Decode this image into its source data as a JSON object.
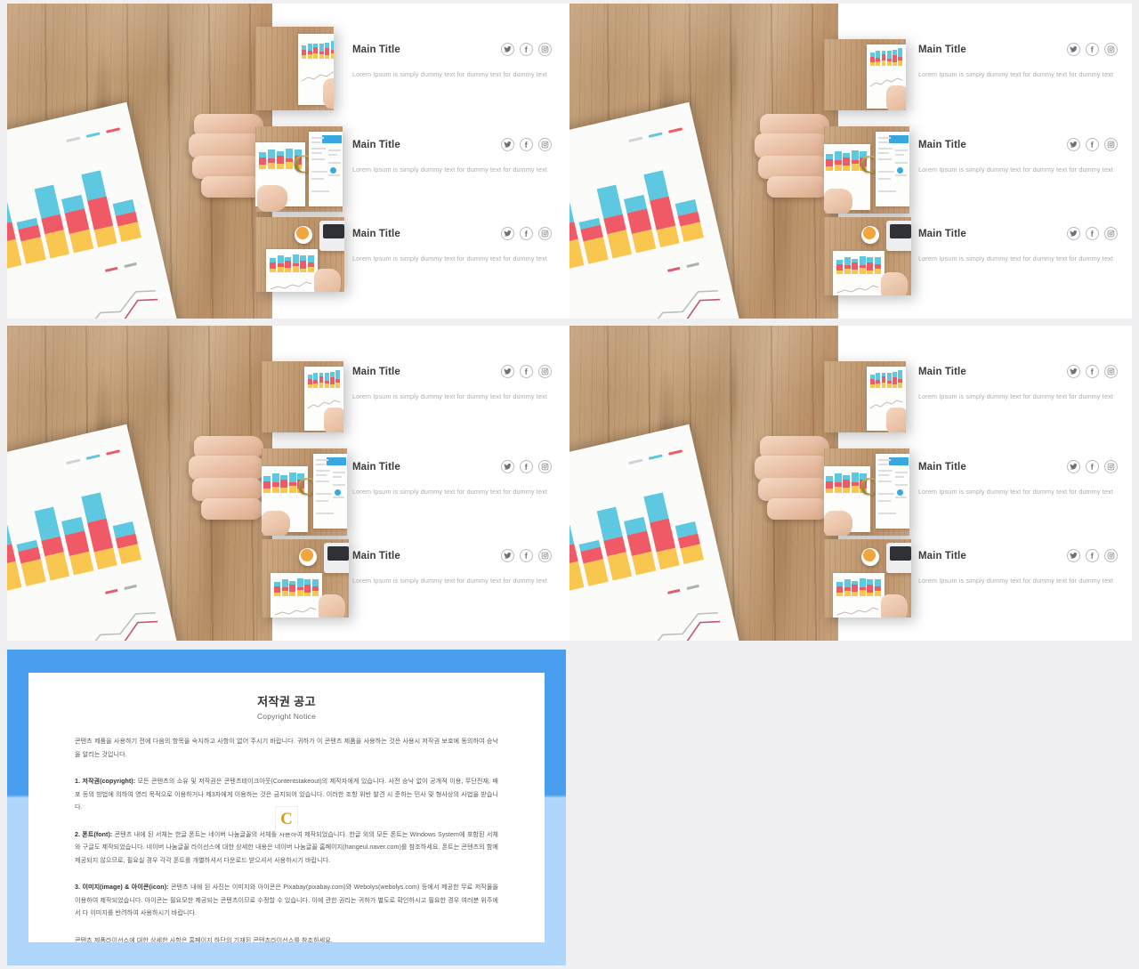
{
  "slides": [
    {
      "id": "slide-1",
      "entries": [
        {
          "title": "Main Title",
          "desc": "Lorem Ipsum is simply dummy text for dummy text for dummy text"
        },
        {
          "title": "Main Title",
          "desc": "Lorem Ipsum is simply dummy text for dummy text for dummy text"
        },
        {
          "title": "Main Title",
          "desc": "Lorem Ipsum is simply dummy text for dummy text for dummy text"
        }
      ]
    },
    {
      "id": "slide-2",
      "entries": [
        {
          "title": "Main Title",
          "desc": "Lorem Ipsum is simply dummy text for dummy text for dummy text"
        },
        {
          "title": "Main Title",
          "desc": "Lorem Ipsum is simply dummy text for dummy text for dummy text"
        },
        {
          "title": "Main Title",
          "desc": "Lorem Ipsum is simply dummy text for dummy text for dummy text"
        }
      ]
    },
    {
      "id": "slide-3",
      "entries": [
        {
          "title": "Main Title",
          "desc": "Lorem Ipsum is simply dummy text for dummy text for dummy text"
        },
        {
          "title": "Main Title",
          "desc": "Lorem Ipsum is simply dummy text for dummy text for dummy text"
        },
        {
          "title": "Main Title",
          "desc": "Lorem Ipsum is simply dummy text for dummy text for dummy text"
        }
      ]
    },
    {
      "id": "slide-4",
      "entries": [
        {
          "title": "Main Title",
          "desc": "Lorem Ipsum is simply dummy text for dummy text for dummy text"
        },
        {
          "title": "Main Title",
          "desc": "Lorem Ipsum is simply dummy text for dummy text for dummy text"
        },
        {
          "title": "Main Title",
          "desc": "Lorem Ipsum is simply dummy text for dummy text for dummy text"
        }
      ]
    }
  ],
  "social_icons": [
    {
      "name": "twitter-icon",
      "label": "Twitter"
    },
    {
      "name": "facebook-icon",
      "label": "Facebook"
    },
    {
      "name": "instagram-icon",
      "label": "Instagram"
    }
  ],
  "copyright": {
    "title": "저작권 공고",
    "subtitle": "Copyright Notice",
    "intro": "콘텐츠 제품을 사용하기 전에 다음의 항목을 숙지하고 사항이 없어 주시기 바랍니다. 귀하가 이 콘텐츠 제품을 사용하는 것은 사용시 저작권 보호에 동의하여 승낙을 알리는 것입니다.",
    "sections": [
      {
        "heading": "1. 저작권(copyright):",
        "body": "모든 콘텐츠의 소유 및 저작권은 콘텐츠테이크아웃(Contentstakeout)의 제작자에게 있습니다. 사전 승낙 없이 공개적 이용, 무단전재, 배포 등의 방법에 의하여 영리 목적으로 이용하거나 제3자에게 이용하는 것은 금지되어 있습니다. 이러한 조항 위반 발견 시 준하는 민사 및 형사상의 사법을 받습니다."
      },
      {
        "heading": "2. 폰트(font):",
        "body": "콘텐츠 내에 된 서체는 한글 폰트는 네이버 나눔글꼴의 서체를 사용하여 제작되었습니다. 한글 외의 모든 폰트는 Windows System에 포함된 서체와 구글도 제작되었습니다. 네이버 나눔글꼴 라이선스에 대한 상세한 내용은 네이버 나눔글꼴 홈페이지(hangeul.naver.com)를 참조하세요. 폰트는 콘텐츠의 함께 제공되지 않으므로, 필요실 경우 각각 폰트를 개별하셔서 다운로드 받으셔서 사용하시기 바랍니다."
      },
      {
        "heading": "3. 이미지(image) & 아이콘(icon):",
        "body": "콘텐츠 내에 된 사진는 이미지와 아이콘은 Pixabay(pixabay.com)와 Webolys(webolys.com) 등에서 제공한 무료 저작물을 이용하여 제작되었습니다. 아이콘는 필요모한 제공되는 콘텐츠이므로 수정할 수 있습니다. 이에 관한 권리는 귀하가 별도로 확인하시고 필요한 경우 여러분 위주에서 다 이미지를 반려하여 사용하시기 바랍니다."
      }
    ],
    "footer": "콘텐츠 제품라이선스에 대한 상세한 사항은 홈페이지 하단의 기재된 콘텐츠라이선스를 참조하세요.",
    "watermark": "C"
  },
  "colors": {
    "accent_blue": "#4a9ef0",
    "accent_blue_light": "#b0d7fb",
    "title_text": "#3b3b3b",
    "body_text": "#a9acb0",
    "gold": "#c9a227"
  }
}
